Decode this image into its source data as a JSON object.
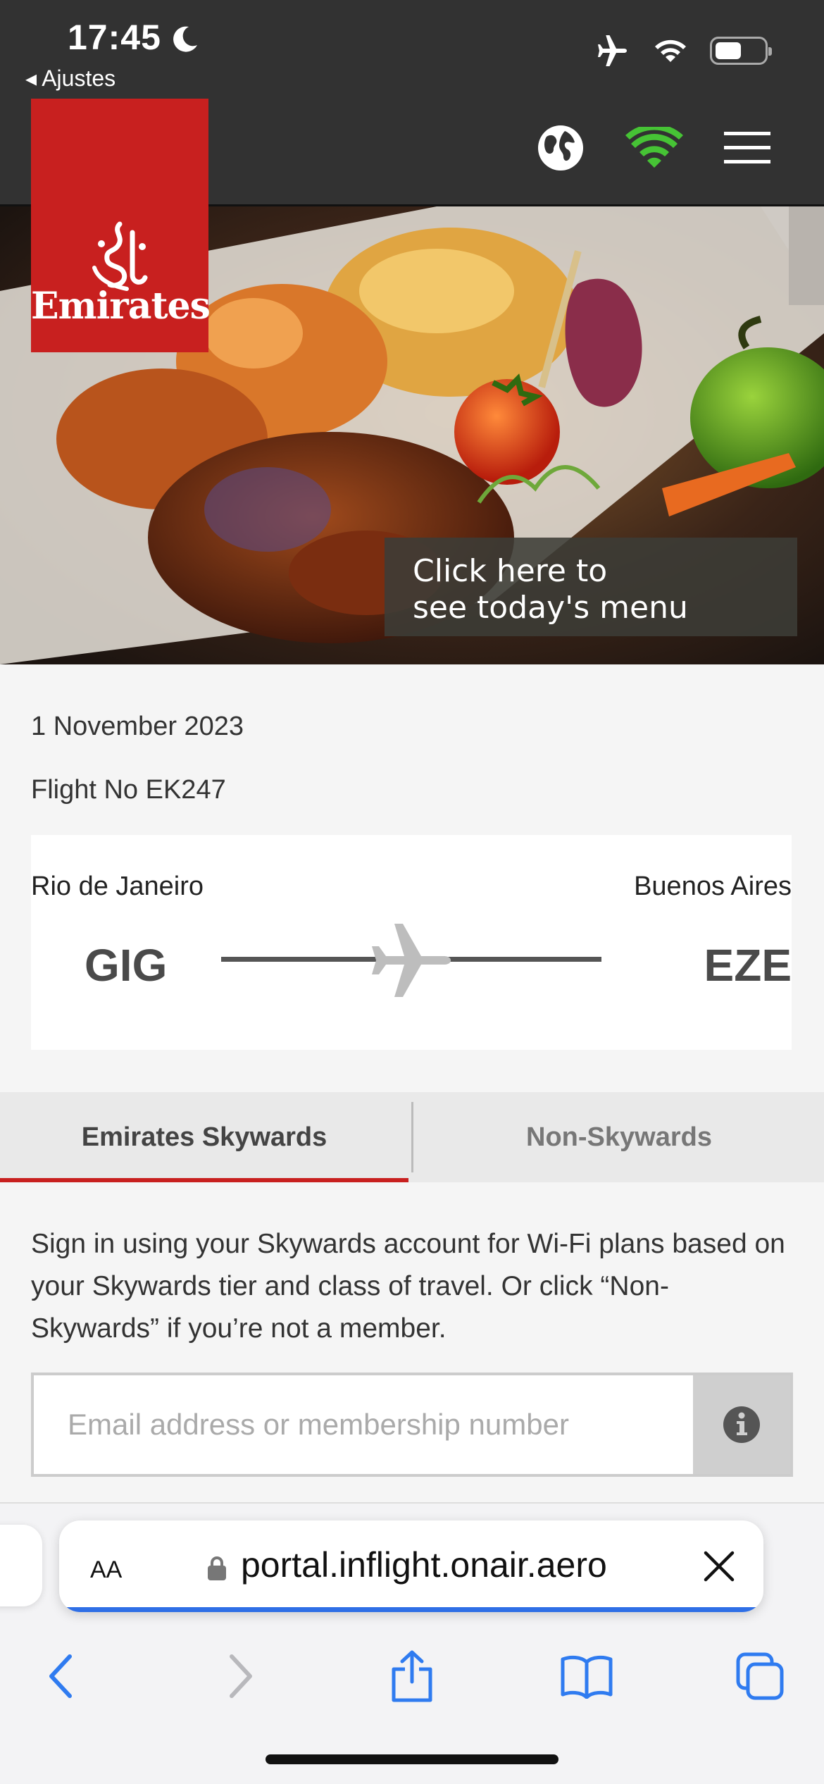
{
  "status_bar": {
    "time": "17:45",
    "back_label": "◂ Ajustes"
  },
  "brand": {
    "logo_text": "Emirates",
    "accent_color": "#c8201f"
  },
  "hero": {
    "cta_line1": "Click here to",
    "cta_line2": "see today's menu"
  },
  "flight": {
    "date": "1 November 2023",
    "number": "Flight No EK247",
    "origin_city": "Rio de Janeiro",
    "origin_code": "GIG",
    "destination_city": "Buenos Aires",
    "destination_code": "EZE"
  },
  "tabs": [
    {
      "label": "Emirates Skywards",
      "active": true
    },
    {
      "label": "Non-Skywards",
      "active": false
    }
  ],
  "signin": {
    "description": "Sign in using your Skywards account for Wi-Fi plans based on your Skywards tier and class of travel. Or click “Non-Skywards” if you’re not a member.",
    "email_placeholder": "Email address or membership number",
    "email_value": ""
  },
  "browser": {
    "text_size_label": "AA",
    "url": "portal.inflight.onair.aero"
  },
  "icons": {
    "status": [
      "moon-icon",
      "airplane-mode-icon",
      "wifi-icon",
      "battery-icon"
    ],
    "header": [
      "globe-icon",
      "wifi-signal-icon",
      "hamburger-menu-icon"
    ],
    "toolbar": [
      "back-chevron-icon",
      "forward-chevron-icon",
      "share-icon",
      "bookmarks-icon",
      "tabs-icon"
    ]
  }
}
